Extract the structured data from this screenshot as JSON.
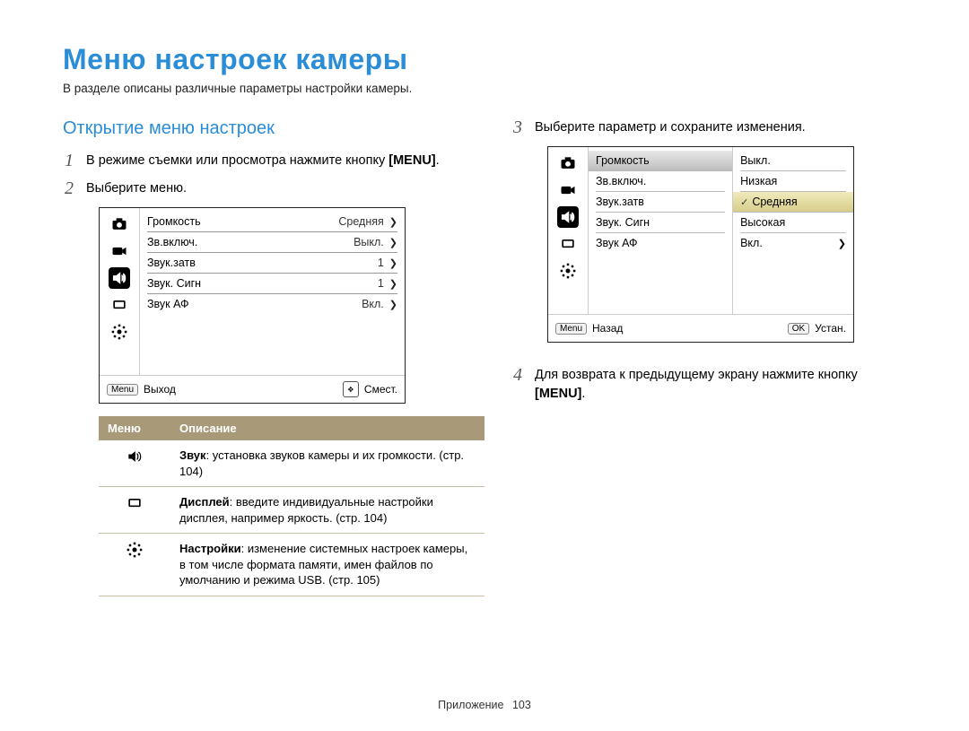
{
  "page": {
    "title": "Меню настроек камеры",
    "subtitle": "В разделе описаны различные параметры настройки камеры.",
    "footer_section": "Приложение",
    "footer_page": "103"
  },
  "left": {
    "heading": "Открытие меню настроек",
    "step1_num": "1",
    "step1_text": "В режиме съемки или просмотра нажмите кнопку",
    "step1_btn": "MENU",
    "period": ".",
    "step2_num": "2",
    "step2_text": "Выберите меню.",
    "lcd": {
      "rows": [
        {
          "label": "Громкость",
          "value": "Средняя"
        },
        {
          "label": "Зв.включ.",
          "value": "Выкл."
        },
        {
          "label": "Звук.затв",
          "value": "1"
        },
        {
          "label": "Звук. Сигн",
          "value": "1"
        },
        {
          "label": "Звук АФ",
          "value": "Вкл."
        }
      ],
      "foot_menu_key": "Menu",
      "foot_left": "Выход",
      "foot_right": "Смест."
    },
    "table": {
      "h1": "Меню",
      "h2": "Описание",
      "r1_bold": "Звук",
      "r1_rest": ": установка звуков камеры и их громкости. (стр. 104)",
      "r2_bold": "Дисплей",
      "r2_rest": ": введите индивидуальные настройки дисплея, например яркость. (стр. 104)",
      "r3_bold": "Настройки",
      "r3_rest": ": изменение системных настроек камеры, в том числе формата памяти, имен файлов по умолчанию и режима USB. (стр. 105)"
    }
  },
  "right": {
    "step3_num": "3",
    "step3_text": "Выберите параметр и сохраните изменения.",
    "lcd": {
      "left_rows": [
        "Громкость",
        "Зв.включ.",
        "Звук.затв",
        "Звук. Сигн",
        "Звук АФ"
      ],
      "right_rows": [
        "Выкл.",
        "Низкая",
        "Средняя",
        "Высокая",
        "Вкл."
      ],
      "highlight_left": 0,
      "highlight_right": 2,
      "last_val": "Вкл.",
      "foot_menu_key": "Menu",
      "foot_left": "Назад",
      "foot_ok_key": "OK",
      "foot_right": "Устан."
    },
    "step4_num": "4",
    "step4_text": "Для возврата к предыдущему экрану нажмите кнопку",
    "step4_btn": "MENU",
    "period": "."
  }
}
